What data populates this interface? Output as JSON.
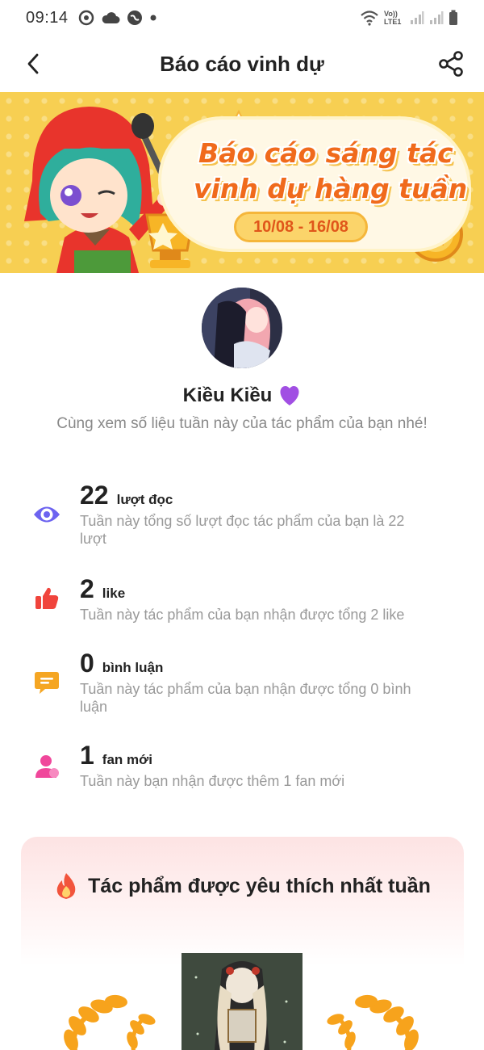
{
  "status_bar": {
    "time": "09:14",
    "network_label": "Vo)) LTE1"
  },
  "header": {
    "title": "Báo cáo vinh dự"
  },
  "banner": {
    "title_line1": "Báo cáo sáng tác",
    "title_line2": "vinh dự hàng tuần",
    "date_range": "10/08 - 16/08"
  },
  "profile": {
    "name": "Kiều Kiều",
    "subtitle": "Cùng xem số liệu tuần này của tác phẩm của bạn nhé!"
  },
  "stats": [
    {
      "icon": "eye-icon",
      "value": "22",
      "unit": "lượt đọc",
      "description": "Tuần này tổng số lượt đọc tác phẩm của bạn là 22 lượt"
    },
    {
      "icon": "thumbs-up-icon",
      "value": "2",
      "unit": "like",
      "description": "Tuần này tác phẩm của bạn nhận được tổng 2 like"
    },
    {
      "icon": "comment-icon",
      "value": "0",
      "unit": "bình luận",
      "description": "Tuần này tác phẩm của bạn nhận được tổng 0 bình luận"
    },
    {
      "icon": "new-fan-icon",
      "value": "1",
      "unit": "fan mới",
      "description": "Tuần này bạn nhận được thêm 1 fan mới"
    }
  ],
  "favorite_card": {
    "title": "Tác phẩm được yêu thích nhất tuần"
  },
  "colors": {
    "accent_orange": "#f06a1c",
    "eye_purple": "#6c63f0",
    "like_red": "#f0443c",
    "comment_orange": "#f5a623",
    "fan_pink": "#f0479b"
  }
}
